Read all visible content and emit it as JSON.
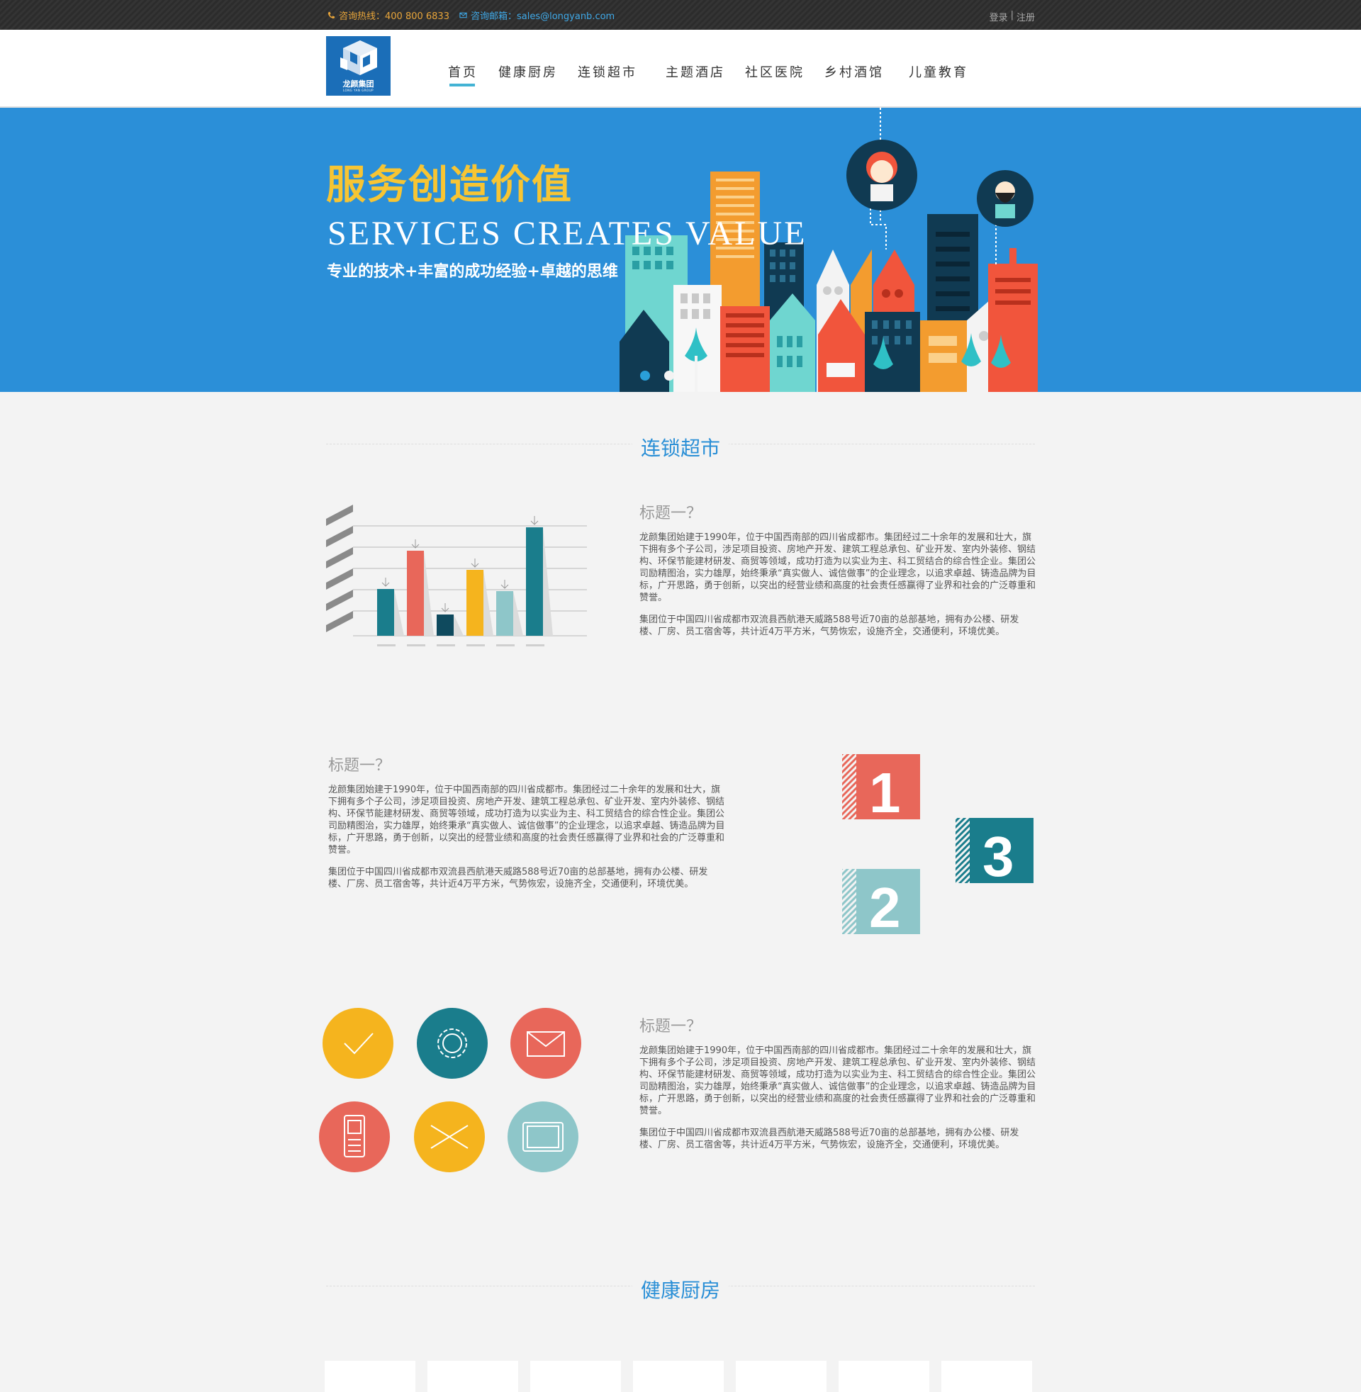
{
  "topbar": {
    "hotline": "咨询热线：400 800 6833",
    "email": "咨询邮箱：sales@longyanb.com",
    "login": "登录",
    "separator": "|",
    "register": "注册"
  },
  "logo": {
    "cn": "龙颜集团",
    "en": "LONG YAN GROUP"
  },
  "nav": {
    "items": [
      "首页",
      "健康厨房",
      "连锁超市",
      "主题酒店",
      "社区医院",
      "乡村酒馆",
      "儿童教育"
    ],
    "active": "首页"
  },
  "banner": {
    "slogan_cn": "服务创造价值",
    "slogan_en": "SERVICES CREATES VALUE",
    "slogan_sub": "专业的技术+丰富的成功经验+卓越的思维"
  },
  "sections": {
    "chain": "连锁超市",
    "kitchen": "健康厨房"
  },
  "features": [
    {
      "title": "标题一？",
      "p1": "龙颜集团始建于1990年，位于中国西南部的四川省成都市。集团经过二十余年的发展和壮大，旗下拥有多个子公司，涉足项目投资、房地产开发、建筑工程总承包、矿业开发、室内外装修、钢结构、环保节能建材研发、商贸等领域，成功打造为以实业为主、科工贸结合的综合性企业。集团公司励精图治，实力雄厚，始终秉承“真实做人、诚信做事”的企业理念，以追求卓越、铸造品牌为目标，广开思路，勇于创新，以突出的经营业绩和高度的社会责任感赢得了业界和社会的广泛尊重和赞誉。",
      "p2": "集团位于中国四川省成都市双流县西航港天威路588号近70亩的总部基地，拥有办公楼、研发楼、厂房、员工宿舍等，共计近4万平方米，气势恢宏，设施齐全，交通便利，环境优美。"
    },
    {
      "title": "标题一？",
      "p1": "龙颜集团始建于1990年，位于中国西南部的四川省成都市。集团经过二十余年的发展和壮大，旗下拥有多个子公司，涉足项目投资、房地产开发、建筑工程总承包、矿业开发、室内外装修、钢结构、环保节能建材研发、商贸等领域，成功打造为以实业为主、科工贸结合的综合性企业。集团公司励精图治，实力雄厚，始终秉承“真实做人、诚信做事”的企业理念，以追求卓越、铸造品牌为目标，广开思路，勇于创新，以突出的经营业绩和高度的社会责任感赢得了业界和社会的广泛尊重和赞誉。",
      "p2": "集团位于中国四川省成都市双流县西航港天威路588号近70亩的总部基地，拥有办公楼、研发楼、厂房、员工宿舍等，共计近4万平方米，气势恢宏，设施齐全，交通便利，环境优美。"
    },
    {
      "title": "标题一？",
      "p1": "龙颜集团始建于1990年，位于中国西南部的四川省成都市。集团经过二十余年的发展和壮大，旗下拥有多个子公司，涉足项目投资、房地产开发、建筑工程总承包、矿业开发、室内外装修、钢结构、环保节能建材研发、商贸等领域，成功打造为以实业为主、科工贸结合的综合性企业。集团公司励精图治，实力雄厚，始终秉承“真实做人、诚信做事”的企业理念，以追求卓越、铸造品牌为目标，广开思路，勇于创新，以突出的经营业绩和高度的社会责任感赢得了业界和社会的广泛尊重和赞誉。",
      "p2": "集团位于中国四川省成都市双流县西航港天威路588号近70亩的总部基地，拥有办公楼、研发楼、厂房、员工宿舍等，共计近4万平方米，气势恢宏，设施齐全，交通便利，环境优美。"
    }
  ],
  "illustration_chart": {
    "values": [
      2.2,
      4.0,
      1.0,
      3.1,
      2.1,
      5.1
    ],
    "colors": [
      "#1a7d8c",
      "#e8675a",
      "#0f4a5e",
      "#f5b41e",
      "#8ec6c9",
      "#1a7d8c"
    ]
  },
  "numbered_tiles": [
    {
      "label": "1",
      "color": "#e8675a"
    },
    {
      "label": "2",
      "color": "#8ec6c9"
    },
    {
      "label": "3",
      "color": "#1a7d8c"
    }
  ],
  "icon_circles": [
    {
      "icon": "check-icon",
      "color": "#f5b41e"
    },
    {
      "icon": "gear-icon",
      "color": "#1a7d8c"
    },
    {
      "icon": "mail-icon",
      "color": "#e8675a"
    },
    {
      "icon": "phone-icon",
      "color": "#e8675a"
    },
    {
      "icon": "envelope-open-icon",
      "color": "#f5b41e"
    },
    {
      "icon": "tablet-icon",
      "color": "#8ec6c9"
    }
  ],
  "colors": {
    "brand_blue": "#2b8fd8",
    "accent_yellow": "#f7c533",
    "nav_underline": "#43b3d4"
  }
}
